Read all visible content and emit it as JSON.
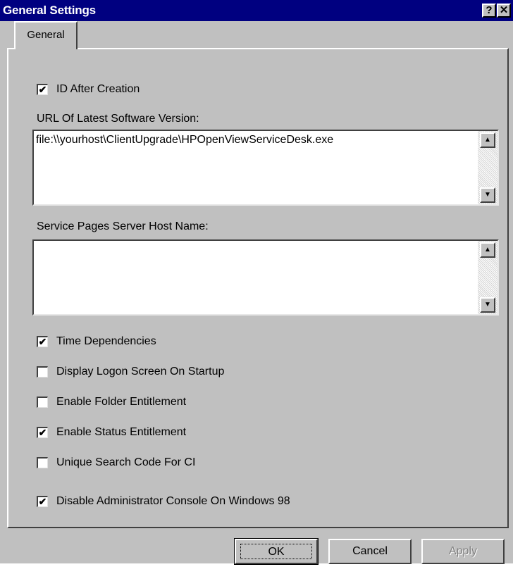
{
  "window": {
    "title": "General Settings",
    "help_button": "?",
    "close_button": "✕"
  },
  "tabs": [
    {
      "label": "General",
      "selected": true
    }
  ],
  "settings": {
    "id_after_creation": {
      "label": "ID After Creation",
      "checked": true
    },
    "url_latest_version": {
      "label": "URL Of Latest Software Version:",
      "value": "file:\\\\yourhost\\ClientUpgrade\\HPOpenViewServiceDesk.exe"
    },
    "service_pages_host": {
      "label": "Service Pages Server Host Name:",
      "value": ""
    },
    "time_dependencies": {
      "label": "Time Dependencies",
      "checked": true
    },
    "display_logon_screen": {
      "label": "Display Logon Screen On Startup",
      "checked": false
    },
    "enable_folder_entitlement": {
      "label": "Enable Folder Entitlement",
      "checked": false
    },
    "enable_status_entitlement": {
      "label": "Enable Status Entitlement",
      "checked": true
    },
    "unique_search_code": {
      "label": "Unique Search Code For CI",
      "checked": false
    },
    "disable_admin_console": {
      "label": "Disable Administrator Console On Windows 98",
      "checked": true
    }
  },
  "buttons": {
    "ok": "OK",
    "cancel": "Cancel",
    "apply": "Apply",
    "apply_enabled": false
  },
  "icons": {
    "checkmark": "✔",
    "scroll_up": "▲",
    "scroll_down": "▼"
  },
  "colors": {
    "titlebar": "#000080",
    "face": "#c0c0c0"
  }
}
